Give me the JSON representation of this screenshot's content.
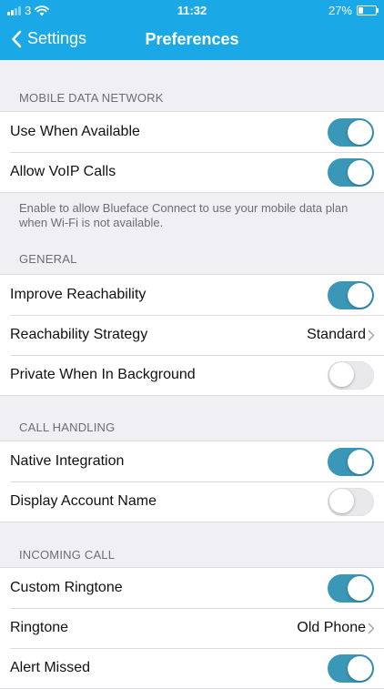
{
  "status_bar": {
    "carrier": "3",
    "time": "11:32",
    "battery": "27%",
    "battery_level": 0.27
  },
  "nav": {
    "back_label": "Settings",
    "title": "Preferences"
  },
  "sections": {
    "mobile_data": {
      "header": "MOBILE DATA NETWORK",
      "use_when_available": {
        "label": "Use When Available",
        "on": true
      },
      "allow_voip": {
        "label": "Allow VoIP Calls",
        "on": true
      },
      "note": "Enable to allow Blueface Connect to use your mobile data plan when Wi-Fi is not available."
    },
    "general": {
      "header": "GENERAL",
      "improve_reachability": {
        "label": "Improve Reachability",
        "on": true
      },
      "reachability_strategy": {
        "label": "Reachability Strategy",
        "value": "Standard"
      },
      "private_background": {
        "label": "Private When In Background",
        "on": false
      }
    },
    "call_handling": {
      "header": "CALL HANDLING",
      "native_integration": {
        "label": "Native Integration",
        "on": true
      },
      "display_account_name": {
        "label": "Display Account Name",
        "on": false
      }
    },
    "incoming_call": {
      "header": "INCOMING CALL",
      "custom_ringtone": {
        "label": "Custom Ringtone",
        "on": true
      },
      "ringtone": {
        "label": "Ringtone",
        "value": "Old Phone"
      },
      "alert_missed": {
        "label": "Alert Missed",
        "on": true
      }
    }
  },
  "colors": {
    "nav_bar": "#1ba8e6",
    "toggle_on": "#3a97b7",
    "toggle_off": "#e9e9eb",
    "background": "#efeff4"
  }
}
